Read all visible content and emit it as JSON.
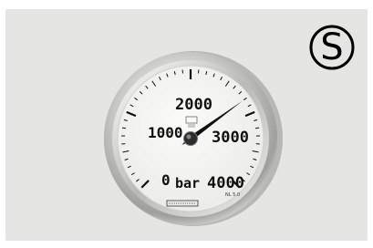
{
  "badge": {
    "letter": "S"
  },
  "gauge": {
    "unit": "bar",
    "scale_labels": [
      "0",
      "1000",
      "2000",
      "3000",
      "4000"
    ],
    "scale_min": 0,
    "scale_max": 4000,
    "needle_value": 2800,
    "small_text": "NL 5.0",
    "colors": {
      "background": "#e5e5e3",
      "dial": "#f7f7f5",
      "bezel": "#c9cac6",
      "ink": "#111111"
    }
  }
}
